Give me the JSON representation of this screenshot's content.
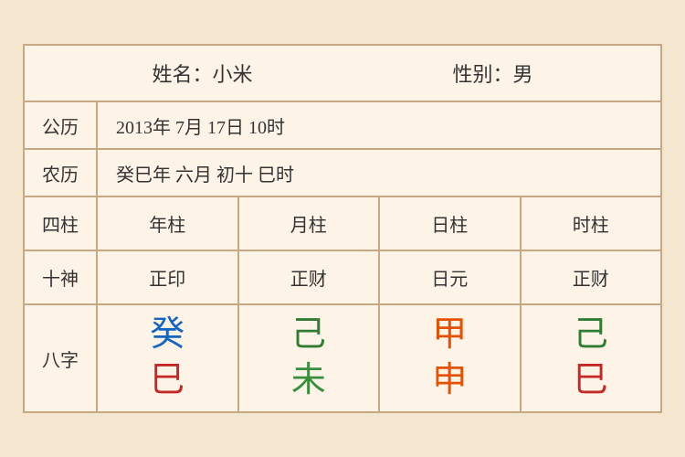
{
  "header": {
    "name_label": "姓名：小米",
    "gender_label": "性别：男"
  },
  "solar": {
    "label": "公历",
    "content": "2013年 7月 17日 10时"
  },
  "lunar": {
    "label": "农历",
    "content": "癸巳年 六月 初十 巳时"
  },
  "sizhu": {
    "label": "四柱",
    "columns": [
      "年柱",
      "月柱",
      "日柱",
      "时柱"
    ]
  },
  "shishen": {
    "label": "十神",
    "columns": [
      "正印",
      "正财",
      "日元",
      "正财"
    ]
  },
  "bazhi": {
    "label": "八字",
    "columns": [
      {
        "top": "癸",
        "top_color": "color-blue",
        "bottom": "巳",
        "bottom_color": "color-red"
      },
      {
        "top": "己",
        "top_color": "color-green",
        "bottom": "未",
        "bottom_color": "color-green2"
      },
      {
        "top": "甲",
        "top_color": "color-orange",
        "bottom": "申",
        "bottom_color": "color-orange"
      },
      {
        "top": "己",
        "top_color": "color-green",
        "bottom": "巳",
        "bottom_color": "color-red"
      }
    ]
  }
}
